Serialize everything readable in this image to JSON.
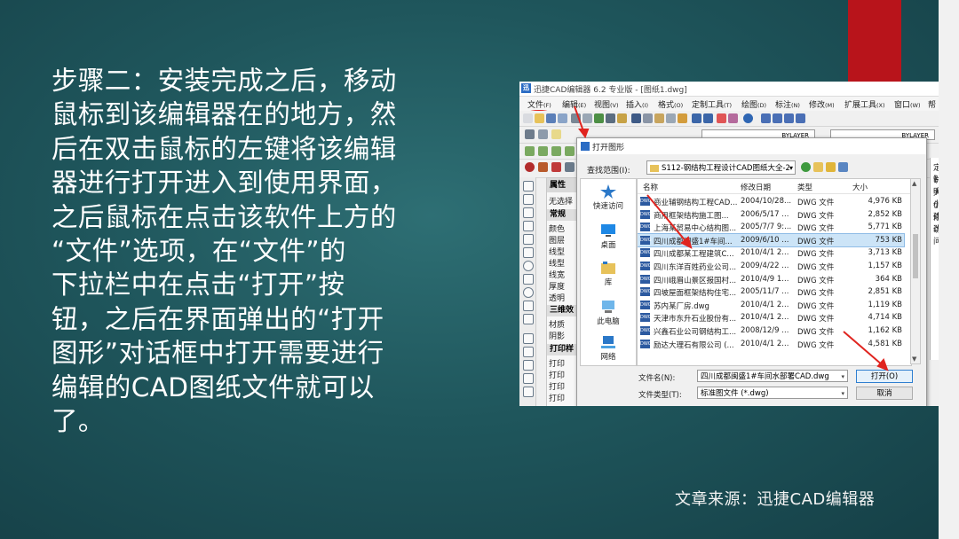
{
  "tutorial": {
    "text": "步骤二：安装完成之后，移动\n鼠标到该编辑器在的地方，然\n后在双击鼠标的左键将该编辑\n器进行打开进入到使用界面，\n之后鼠标在点击该软件上方的\n“文件”选项，在“文件”的\n下拉栏中在点击“打开”按\n钮，之后在界面弹出的“打开\n图形”对话框中打开需要进行\n编辑的CAD图纸文件就可以\n了。"
  },
  "source": "文章来源：迅捷CAD编辑器",
  "colors": {
    "accent_red": "#b8141b",
    "background": "#1f565c",
    "highlight_ring": "#e0241f",
    "selection": "#cce4f7"
  },
  "app": {
    "app_icon": "迅",
    "title": "迅捷CAD编辑器 6.2 专业版 - [图纸1.dwg]",
    "menu": [
      {
        "label": "文件",
        "key": "(F)"
      },
      {
        "label": "编辑",
        "key": "(E)"
      },
      {
        "label": "视图",
        "key": "(V)"
      },
      {
        "label": "插入",
        "key": "(I)"
      },
      {
        "label": "格式",
        "key": "(O)"
      },
      {
        "label": "定制工具",
        "key": "(T)"
      },
      {
        "label": "绘图",
        "key": "(D)"
      },
      {
        "label": "标注",
        "key": "(N)"
      },
      {
        "label": "修改",
        "key": "(M)"
      },
      {
        "label": "扩展工具",
        "key": "(X)"
      },
      {
        "label": "窗口",
        "key": "(W)"
      },
      {
        "label": "帮",
        "key": ""
      }
    ],
    "layer_combo_1": "BYLAYER",
    "layer_combo_2": "BYLAYER",
    "props_panel": {
      "title": "属性",
      "selection": "无选择",
      "section_1": "常规",
      "rows_1": [
        "颜色",
        "图层",
        "线型",
        "线型",
        "线宽",
        "厚度",
        "透明"
      ],
      "section_2": "三维效",
      "rows_2": [
        "材质",
        "阴影"
      ],
      "section_3": "打印样",
      "rows_3": [
        "打印",
        "打印",
        "打印",
        "打印"
      ]
    },
    "right_panel": [
      "定制",
      "说明",
      "大小",
      "创建",
      "修改",
      "访问"
    ]
  },
  "dialog": {
    "title": "打开图形",
    "look_in_label": "查找范围(I):",
    "look_in_value": "S112-钢结构工程设计CAD图纸大全-2",
    "places": [
      "快速访问",
      "桌面",
      "库",
      "此电脑",
      "网络"
    ],
    "columns": [
      "名称",
      "修改日期",
      "类型",
      "大小"
    ],
    "files": [
      {
        "name": "商业辅钢结构工程CAD...",
        "date": "2004/10/28...",
        "type": "DWG 文件",
        "size": "4,976 KB"
      },
      {
        "name": "商用框架结构施工图...",
        "date": "2006/5/17 ...",
        "type": "DWG 文件",
        "size": "2,852 KB"
      },
      {
        "name": "上海某贸易中心结构图...",
        "date": "2005/7/7 9:...",
        "type": "DWG 文件",
        "size": "5,771 KB"
      },
      {
        "name": "四川成都闽盛1#车间...",
        "date": "2009/6/10 ...",
        "type": "DWG 文件",
        "size": "753 KB"
      },
      {
        "name": "四川成都某工程建筑C...",
        "date": "2010/4/1 2...",
        "type": "DWG 文件",
        "size": "3,713 KB"
      },
      {
        "name": "四川东洋百姓药业公司...",
        "date": "2009/4/22 ...",
        "type": "DWG 文件",
        "size": "1,157 KB"
      },
      {
        "name": "四川峨眉山景区报国村...",
        "date": "2010/4/9 1...",
        "type": "DWG 文件",
        "size": "364 KB"
      },
      {
        "name": "四坡屋面框架结构住宅...",
        "date": "2005/11/7 ...",
        "type": "DWG 文件",
        "size": "2,851 KB"
      },
      {
        "name": "苏内某厂房.dwg",
        "date": "2010/4/1 2...",
        "type": "DWG 文件",
        "size": "1,119 KB"
      },
      {
        "name": "天津市东升石业股份有...",
        "date": "2010/4/1 2...",
        "type": "DWG 文件",
        "size": "4,714 KB"
      },
      {
        "name": "兴鑫石业公司钢结构工...",
        "date": "2008/12/9 ...",
        "type": "DWG 文件",
        "size": "1,162 KB"
      },
      {
        "name": "励达大理石有限公司 (...",
        "date": "2010/4/1 2...",
        "type": "DWG 文件",
        "size": "4,581 KB"
      }
    ],
    "selected_index": 3,
    "file_name_label": "文件名(N):",
    "file_name_value": "四川成都闽盛1#车间水部署CAD.dwg",
    "file_type_label": "文件类型(T):",
    "file_type_value": "标准图文件 (*.dwg)",
    "open_button": "打开(O)",
    "cancel_button": "取消"
  }
}
